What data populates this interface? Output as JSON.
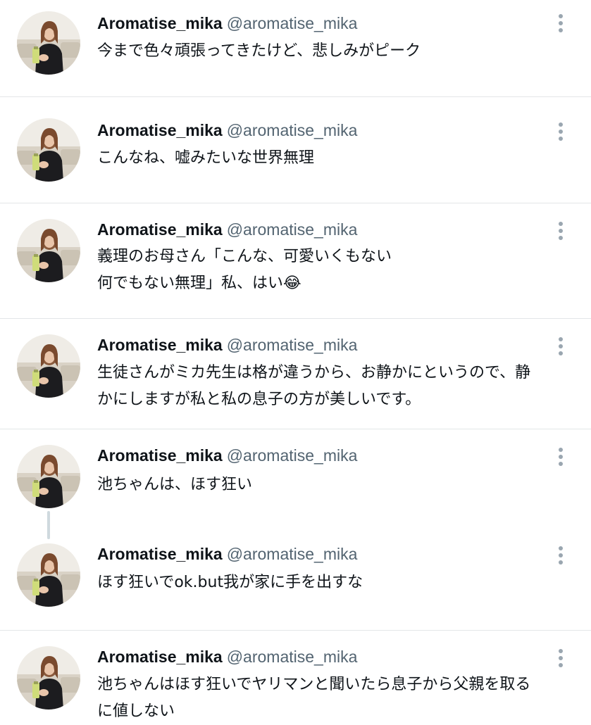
{
  "tweets": [
    {
      "display_name": "Aromatise_mika",
      "handle": "@aromatise_mika",
      "text": "今まで色々頑張ってきたけど、悲しみがピーク"
    },
    {
      "display_name": "Aromatise_mika",
      "handle": "@aromatise_mika",
      "text": "こんなね、嘘みたいな世界無理"
    },
    {
      "display_name": "Aromatise_mika",
      "handle": "@aromatise_mika",
      "text": "義理のお母さん「こんな、可愛いくもない\n何でもない無理」私、はい😂"
    },
    {
      "display_name": "Aromatise_mika",
      "handle": "@aromatise_mika",
      "text": "生徒さんがミカ先生は格が違うから、お静かにというので、静\nかにしますが私と私の息子の方が美しいです。"
    },
    {
      "display_name": "Aromatise_mika",
      "handle": "@aromatise_mika",
      "text": "池ちゃんは、ほす狂い"
    },
    {
      "display_name": "Aromatise_mika",
      "handle": "@aromatise_mika",
      "text": "ほす狂いでok.but我が家に手を出すな"
    },
    {
      "display_name": "Aromatise_mika",
      "handle": "@aromatise_mika",
      "text": "池ちゃんはほす狂いでヤリマンと聞いたら息子から父親を取る\nに値しない"
    }
  ],
  "icons": {
    "more": "more-vertical-icon",
    "avatar": "avatar-photo"
  },
  "colors": {
    "name": "#0f1419",
    "handle": "#536471",
    "divider": "#e3e6e8",
    "more_icon": "#9aa6b0",
    "thread_line": "#cfd9de"
  }
}
